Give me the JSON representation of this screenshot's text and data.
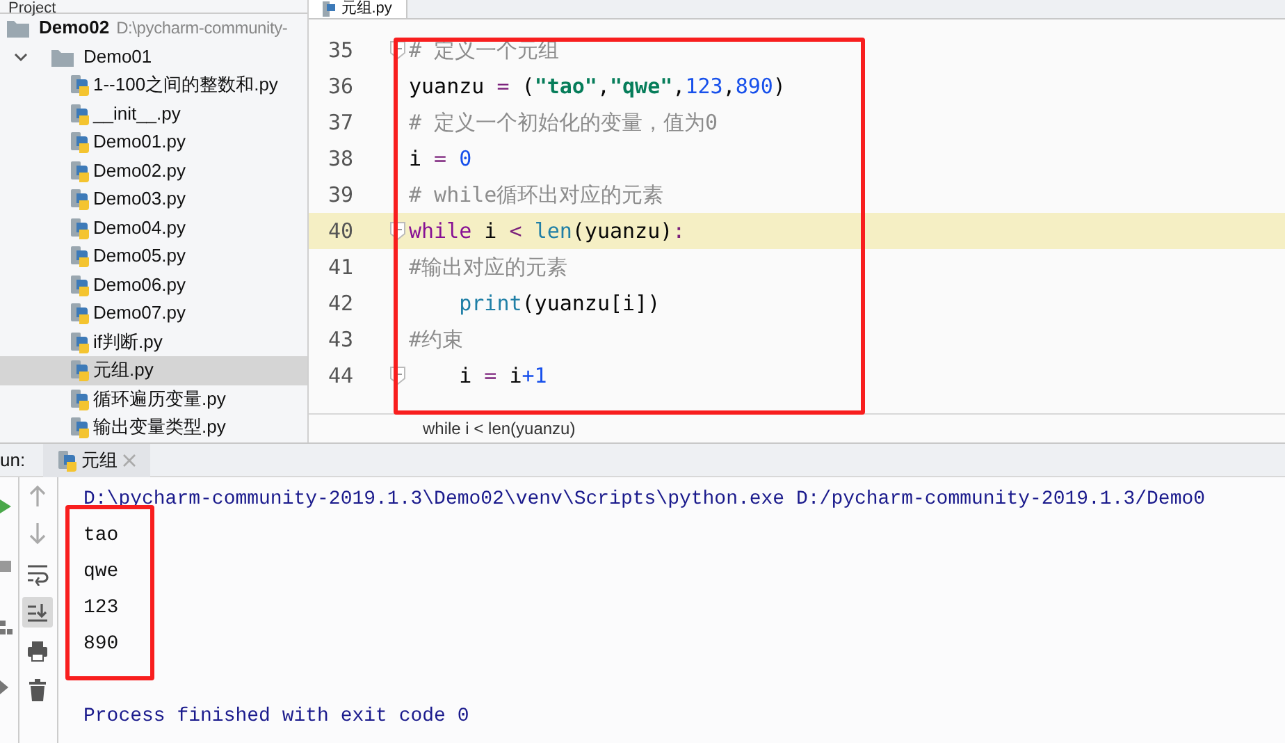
{
  "project_panel": {
    "title": "Project",
    "tree": [
      {
        "label": "Demo02",
        "path": "D:\\pycharm-community-",
        "kind": "root",
        "selected": false,
        "children": [
          {
            "label": "Demo01",
            "kind": "folder",
            "expanded": true,
            "selected": false,
            "children": [
              {
                "label": "1--100之间的整数和.py",
                "kind": "file",
                "selected": false
              },
              {
                "label": "__init__.py",
                "kind": "file",
                "selected": false
              },
              {
                "label": "Demo01.py",
                "kind": "file",
                "selected": false
              },
              {
                "label": "Demo02.py",
                "kind": "file",
                "selected": false
              },
              {
                "label": "Demo03.py",
                "kind": "file",
                "selected": false
              },
              {
                "label": "Demo04.py",
                "kind": "file",
                "selected": false
              },
              {
                "label": "Demo05.py",
                "kind": "file",
                "selected": false
              },
              {
                "label": "Demo06.py",
                "kind": "file",
                "selected": false
              },
              {
                "label": "Demo07.py",
                "kind": "file",
                "selected": false
              },
              {
                "label": "if判断.py",
                "kind": "file",
                "selected": false
              },
              {
                "label": "元组.py",
                "kind": "file",
                "selected": true
              },
              {
                "label": "循环遍历变量.py",
                "kind": "file",
                "selected": false
              },
              {
                "label": "输出变量类型.py",
                "kind": "file",
                "selected": false
              }
            ]
          }
        ]
      }
    ]
  },
  "editor": {
    "tab": "元组.py",
    "framed": true,
    "lines": [
      {
        "number": "35",
        "fold": true,
        "current": false,
        "indented": false,
        "segments": [
          {
            "text": "# 定义一个元组",
            "kind": "comment"
          }
        ]
      },
      {
        "number": "36",
        "fold": false,
        "current": false,
        "indented": false,
        "segments": [
          {
            "text": "yuanzu",
            "kind": "ident"
          },
          {
            "text": " = ",
            "kind": "op"
          },
          {
            "text": "(",
            "kind": "ident"
          },
          {
            "text": "\"tao\"",
            "kind": "string"
          },
          {
            "text": ",",
            "kind": "ident"
          },
          {
            "text": "\"qwe\"",
            "kind": "string"
          },
          {
            "text": ",",
            "kind": "ident"
          },
          {
            "text": "123",
            "kind": "number"
          },
          {
            "text": ",",
            "kind": "ident"
          },
          {
            "text": "890",
            "kind": "number"
          },
          {
            "text": ")",
            "kind": "ident"
          }
        ]
      },
      {
        "number": "37",
        "fold": false,
        "current": false,
        "indented": false,
        "segments": [
          {
            "text": "# 定义一个初始化的变量，值为0",
            "kind": "comment"
          }
        ]
      },
      {
        "number": "38",
        "fold": false,
        "current": false,
        "indented": false,
        "segments": [
          {
            "text": "i",
            "kind": "ident"
          },
          {
            "text": " = ",
            "kind": "op"
          },
          {
            "text": "0",
            "kind": "number"
          }
        ]
      },
      {
        "number": "39",
        "fold": false,
        "current": false,
        "indented": false,
        "segments": [
          {
            "text": "# while循环出对应的元素",
            "kind": "comment"
          }
        ]
      },
      {
        "number": "40",
        "fold": true,
        "current": true,
        "indented": false,
        "segments": [
          {
            "text": "while",
            "kind": "keyword"
          },
          {
            "text": " i ",
            "kind": "ident"
          },
          {
            "text": "< ",
            "kind": "op"
          },
          {
            "text": "len",
            "kind": "builtin"
          },
          {
            "text": "(yuanzu)",
            "kind": "ident"
          },
          {
            "text": ":",
            "kind": "op"
          }
        ]
      },
      {
        "number": "41",
        "fold": false,
        "current": false,
        "indented": false,
        "segments": [
          {
            "text": "#输出对应的元素",
            "kind": "comment"
          }
        ]
      },
      {
        "number": "42",
        "fold": false,
        "current": false,
        "indented": true,
        "segments": [
          {
            "text": "print",
            "kind": "builtin"
          },
          {
            "text": "(yuanzu[i])",
            "kind": "ident"
          }
        ]
      },
      {
        "number": "43",
        "fold": false,
        "current": false,
        "indented": false,
        "segments": [
          {
            "text": "#约束",
            "kind": "comment"
          }
        ]
      },
      {
        "number": "44",
        "fold": true,
        "current": false,
        "indented": true,
        "segments": [
          {
            "text": "i",
            "kind": "ident"
          },
          {
            "text": " = ",
            "kind": "op"
          },
          {
            "text": "i",
            "kind": "ident"
          },
          {
            "text": "+1",
            "kind": "number"
          }
        ]
      }
    ],
    "breadcrumb": "while i < len(yuanzu)"
  },
  "run_panel": {
    "label": "un:",
    "tab": "元组",
    "framed": true,
    "output": [
      {
        "text": "D:\\pycharm-community-2019.1.3\\Demo02\\venv\\Scripts\\python.exe D:/pycharm-community-2019.1.3/Demo0",
        "kind": "system"
      },
      {
        "text": "tao",
        "kind": "stdout"
      },
      {
        "text": "qwe",
        "kind": "stdout"
      },
      {
        "text": "123",
        "kind": "stdout"
      },
      {
        "text": "890",
        "kind": "stdout"
      },
      {
        "kind": "blank"
      },
      {
        "text": "Process finished with exit code 0",
        "kind": "system"
      }
    ]
  }
}
